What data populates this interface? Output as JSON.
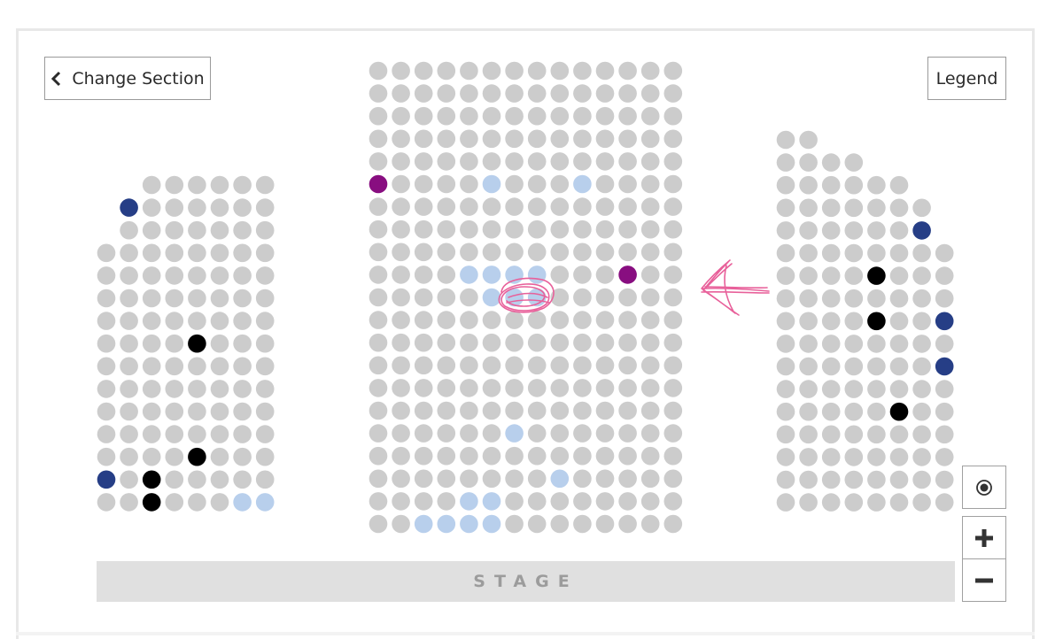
{
  "header": {
    "change_section_label": "Change Section",
    "legend_label": "Legend"
  },
  "stage": {
    "label": "STAGE"
  },
  "map_controls": {
    "locate_icon": "target-icon",
    "zoom_in_icon": "plus-icon",
    "zoom_out_icon": "minus-icon"
  },
  "seat_colors": {
    "available": "#cccccc",
    "blue": "#263e86",
    "black": "#000000",
    "light_blue": "#b8cfec",
    "purple": "#880e80"
  },
  "annotation_color": "#e8609a",
  "sections": [
    {
      "name": "left",
      "rows": [
        {
          "start": 2,
          "count": 6
        },
        {
          "start": 1,
          "count": 7
        },
        {
          "start": 1,
          "count": 7
        },
        {
          "start": 0,
          "count": 8
        },
        {
          "start": 0,
          "count": 8
        },
        {
          "start": 0,
          "count": 8
        },
        {
          "start": 0,
          "count": 8
        },
        {
          "start": 0,
          "count": 8
        },
        {
          "start": 0,
          "count": 8
        },
        {
          "start": 0,
          "count": 8
        },
        {
          "start": 0,
          "count": 8
        },
        {
          "start": 0,
          "count": 8
        },
        {
          "start": 0,
          "count": 8
        },
        {
          "start": 0,
          "count": 8
        },
        {
          "start": 0,
          "count": 8
        }
      ],
      "special": [
        {
          "row": 1,
          "col": 1,
          "color": "blue"
        },
        {
          "row": 7,
          "col": 4,
          "color": "black"
        },
        {
          "row": 12,
          "col": 4,
          "color": "black"
        },
        {
          "row": 13,
          "col": 0,
          "color": "blue"
        },
        {
          "row": 13,
          "col": 2,
          "color": "black"
        },
        {
          "row": 14,
          "col": 2,
          "color": "black"
        },
        {
          "row": 14,
          "col": 6,
          "color": "light_blue"
        },
        {
          "row": 14,
          "col": 7,
          "color": "light_blue"
        }
      ]
    },
    {
      "name": "center",
      "rows": [
        {
          "start": 0,
          "count": 14
        },
        {
          "start": 0,
          "count": 14
        },
        {
          "start": 0,
          "count": 14
        },
        {
          "start": 0,
          "count": 14
        },
        {
          "start": 0,
          "count": 14
        },
        {
          "start": 0,
          "count": 14
        },
        {
          "start": 0,
          "count": 14
        },
        {
          "start": 0,
          "count": 14
        },
        {
          "start": 0,
          "count": 14
        },
        {
          "start": 0,
          "count": 14
        },
        {
          "start": 0,
          "count": 14
        },
        {
          "start": 0,
          "count": 14
        },
        {
          "start": 0,
          "count": 14
        },
        {
          "start": 0,
          "count": 14
        },
        {
          "start": 0,
          "count": 14
        },
        {
          "start": 0,
          "count": 14
        },
        {
          "start": 0,
          "count": 14
        },
        {
          "start": 0,
          "count": 14
        },
        {
          "start": 0,
          "count": 14
        },
        {
          "start": 0,
          "count": 14
        },
        {
          "start": 0,
          "count": 14
        }
      ],
      "special": [
        {
          "row": 5,
          "col": 0,
          "color": "purple"
        },
        {
          "row": 5,
          "col": 5,
          "color": "light_blue"
        },
        {
          "row": 5,
          "col": 9,
          "color": "light_blue"
        },
        {
          "row": 9,
          "col": 4,
          "color": "light_blue"
        },
        {
          "row": 9,
          "col": 5,
          "color": "light_blue"
        },
        {
          "row": 9,
          "col": 6,
          "color": "light_blue"
        },
        {
          "row": 9,
          "col": 7,
          "color": "light_blue"
        },
        {
          "row": 9,
          "col": 11,
          "color": "purple"
        },
        {
          "row": 10,
          "col": 5,
          "color": "light_blue"
        },
        {
          "row": 10,
          "col": 6,
          "color": "light_blue"
        },
        {
          "row": 10,
          "col": 7,
          "color": "light_blue"
        },
        {
          "row": 16,
          "col": 6,
          "color": "light_blue"
        },
        {
          "row": 18,
          "col": 8,
          "color": "light_blue"
        },
        {
          "row": 19,
          "col": 4,
          "color": "light_blue"
        },
        {
          "row": 19,
          "col": 5,
          "color": "light_blue"
        },
        {
          "row": 20,
          "col": 2,
          "color": "light_blue"
        },
        {
          "row": 20,
          "col": 3,
          "color": "light_blue"
        },
        {
          "row": 20,
          "col": 4,
          "color": "light_blue"
        },
        {
          "row": 20,
          "col": 5,
          "color": "light_blue"
        }
      ]
    },
    {
      "name": "right",
      "rows": [
        {
          "start": 0,
          "count": 2
        },
        {
          "start": 0,
          "count": 4
        },
        {
          "start": 0,
          "count": 6
        },
        {
          "start": 0,
          "count": 7
        },
        {
          "start": 0,
          "count": 7
        },
        {
          "start": 0,
          "count": 8
        },
        {
          "start": 0,
          "count": 8
        },
        {
          "start": 0,
          "count": 8
        },
        {
          "start": 0,
          "count": 8
        },
        {
          "start": 0,
          "count": 8
        },
        {
          "start": 0,
          "count": 8
        },
        {
          "start": 0,
          "count": 8
        },
        {
          "start": 0,
          "count": 8
        },
        {
          "start": 0,
          "count": 8
        },
        {
          "start": 0,
          "count": 8
        },
        {
          "start": 0,
          "count": 8
        },
        {
          "start": 0,
          "count": 8
        }
      ],
      "special": [
        {
          "row": 4,
          "col": 6,
          "color": "blue"
        },
        {
          "row": 6,
          "col": 4,
          "color": "black"
        },
        {
          "row": 8,
          "col": 4,
          "color": "black"
        },
        {
          "row": 8,
          "col": 7,
          "color": "blue"
        },
        {
          "row": 10,
          "col": 7,
          "color": "blue"
        },
        {
          "row": 12,
          "col": 5,
          "color": "black"
        }
      ]
    }
  ]
}
